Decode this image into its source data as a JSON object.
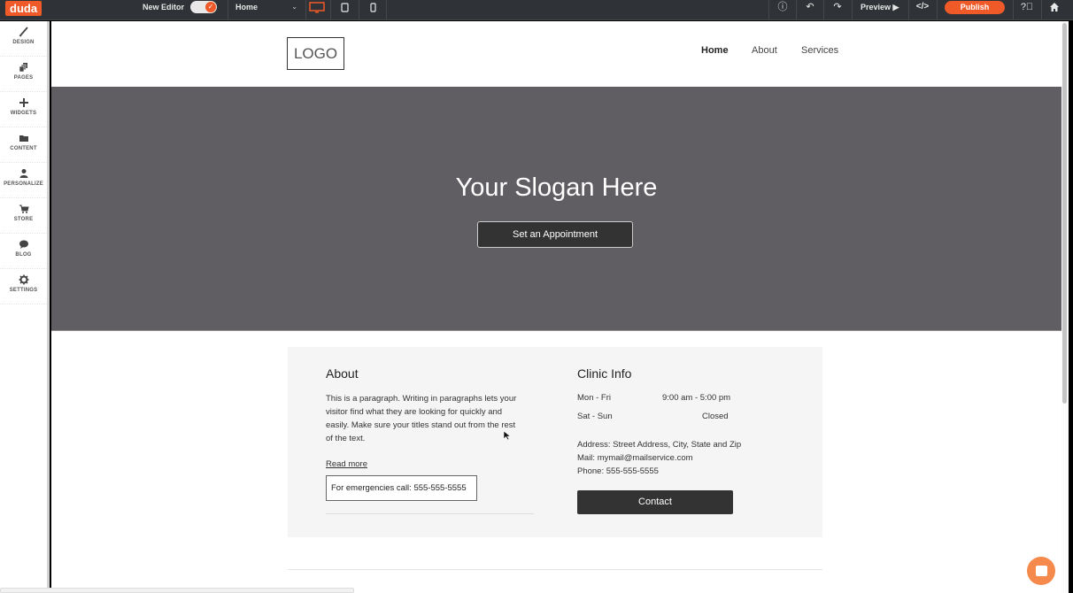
{
  "topbar": {
    "brand": "duda",
    "new_editor_label": "New Editor",
    "new_editor_enabled": true,
    "page_select_value": "Home",
    "devices": [
      "desktop",
      "tablet",
      "mobile"
    ],
    "active_device": "desktop",
    "preview_label": "Preview ▶",
    "publish_label": "Publish",
    "accent_color": "#f05a28"
  },
  "sidebar": {
    "items": [
      {
        "label": "DESIGN",
        "icon": "brush-icon"
      },
      {
        "label": "PAGES",
        "icon": "pages-icon"
      },
      {
        "label": "WIDGETS",
        "icon": "plus-icon"
      },
      {
        "label": "CONTENT",
        "icon": "folder-icon"
      },
      {
        "label": "PERSONALIZE",
        "icon": "person-icon"
      },
      {
        "label": "STORE",
        "icon": "cart-icon"
      },
      {
        "label": "BLOG",
        "icon": "speech-bubble-icon"
      },
      {
        "label": "SETTINGS",
        "icon": "gear-icon"
      }
    ]
  },
  "site": {
    "logo_text": "LOGO",
    "nav": [
      {
        "label": "Home",
        "active": true
      },
      {
        "label": "About",
        "active": false
      },
      {
        "label": "Services",
        "active": false
      }
    ],
    "hero": {
      "slogan": "Your Slogan Here",
      "cta_label": "Set an Appointment"
    },
    "about": {
      "title": "About",
      "paragraph": "This is a paragraph. Writing in paragraphs lets your visitor find what they are looking for quickly and easily. Make sure your titles stand out from the rest of the text.",
      "read_more": "Read more",
      "emergency": "For emergencies call: 555-555-5555"
    },
    "clinic": {
      "title": "Clinic Info",
      "hours": [
        {
          "days": "Mon - Fri",
          "time": "9:00 am - 5:00 pm"
        },
        {
          "days": "Sat - Sun",
          "time": "Closed"
        }
      ],
      "address": "Address: Street Address, City, State and Zip",
      "mail": "Mail: mymail@mailservice.com",
      "phone": "Phone: 555-555-5555",
      "contact_label": "Contact"
    }
  }
}
